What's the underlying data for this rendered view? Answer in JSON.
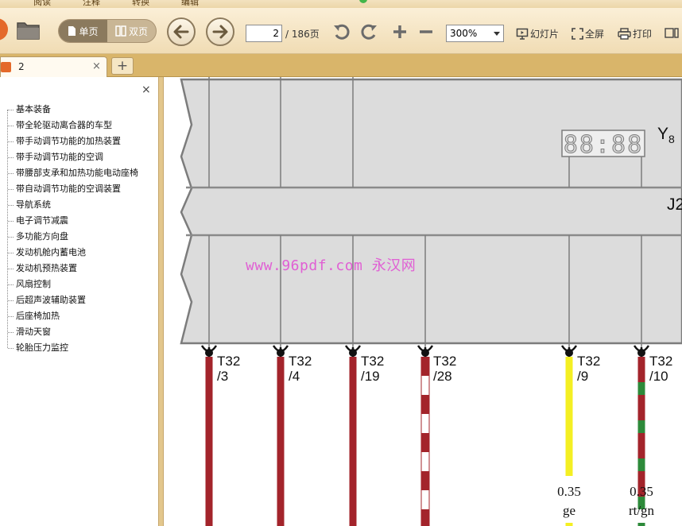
{
  "menu": {
    "tabs": [
      "阅读",
      "注释",
      "转换",
      "编辑"
    ]
  },
  "toolbar": {
    "single_page": "单页",
    "double_page": "双页",
    "current_page": "2",
    "page_total": "/ 186页",
    "zoom": "300%",
    "slideshow": "幻灯片",
    "fullscreen": "全屏",
    "print": "打印"
  },
  "tab": {
    "label": "2",
    "close": "×",
    "new_tab": "+"
  },
  "sidebar": {
    "close": "×",
    "items": [
      "基本装备",
      "带全轮驱动离合器的车型",
      "带手动调节功能的加热装置",
      "带手动调节功能的空调",
      "带腰部支承和加热功能电动座椅",
      "带自动调节功能的空调装置",
      "导航系统",
      "电子调节减震",
      "多功能方向盘",
      "发动机舱内蓄电池",
      "发动机预热装置",
      "风扇控制",
      "后超声波辅助装置",
      "后座椅加热",
      "滑动天窗",
      "轮胎压力监控"
    ]
  },
  "document": {
    "watermark": "www.96pdf.com 永汉网",
    "component_y8": "Y",
    "component_y8_sub": "8",
    "component_j2": "J2",
    "display_digits": "88:88",
    "pins": [
      {
        "line1": "T32",
        "line2": "/3"
      },
      {
        "line1": "T32",
        "line2": "/4"
      },
      {
        "line1": "T32",
        "line2": "/19"
      },
      {
        "line1": "T32",
        "line2": "/28"
      },
      {
        "line1": "T32",
        "line2": "/9"
      },
      {
        "line1": "T32",
        "line2": "/10"
      }
    ],
    "wire_specs": [
      {
        "size": "0.35",
        "color": "ge"
      },
      {
        "size": "0.35",
        "color": "rt/gn"
      }
    ]
  },
  "colors": {
    "wire_red": "#a3242b",
    "wire_white": "#ffffff",
    "wire_yellow": "#f4ef23",
    "wire_green": "#2d8a3a",
    "module_fill": "#dcdcdc",
    "module_stroke": "#7c7c7c",
    "toolbar_bg": "#f4e3c0",
    "tabbar_bg": "#d9b56a"
  }
}
